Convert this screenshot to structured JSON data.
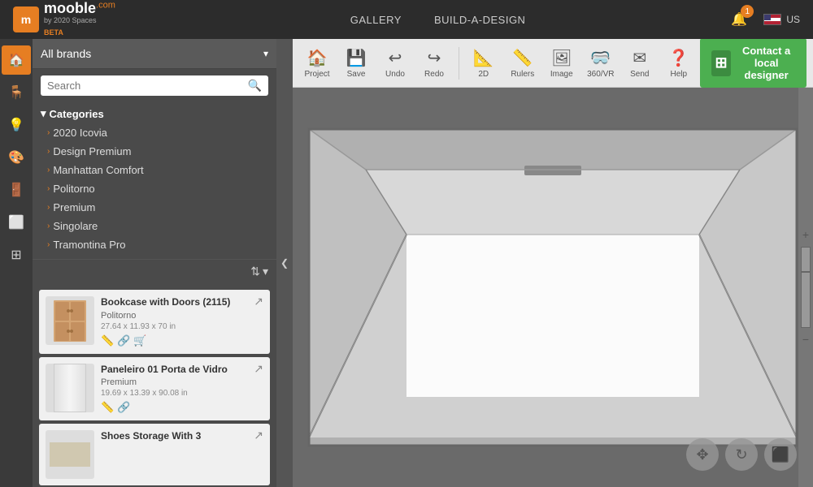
{
  "header": {
    "logo_main": "mooble",
    "logo_com": ".com",
    "logo_sub": "by 2020 Spaces",
    "logo_beta": "BETA",
    "nav_gallery": "GALLERY",
    "nav_build": "BUILD-A-DESIGN",
    "notification_count": "1",
    "lang": "US"
  },
  "sidebar": {
    "brand_dropdown": "All brands",
    "search_placeholder": "Search",
    "categories_label": "Categories",
    "categories": [
      {
        "label": "2020 Icovia"
      },
      {
        "label": "Design Premium"
      },
      {
        "label": "Manhattan Comfort"
      },
      {
        "label": "Politorno"
      },
      {
        "label": "Premium"
      },
      {
        "label": "Singolare"
      },
      {
        "label": "Tramontina Pro"
      }
    ]
  },
  "products": [
    {
      "name": "Bookcase with Doors (2115)",
      "brand": "Politorno",
      "dims": "27.64 x 11.93 x 70 in"
    },
    {
      "name": "Paneleiro 01 Porta de Vidro",
      "brand": "Premium",
      "dims": "19.69 x 13.39 x 90.08 in"
    },
    {
      "name": "Shoes Storage With 3",
      "brand": "",
      "dims": ""
    }
  ],
  "toolbar": {
    "project_label": "Project",
    "save_label": "Save",
    "undo_label": "Undo",
    "redo_label": "Redo",
    "twod_label": "2D",
    "rulers_label": "Rulers",
    "image_label": "Image",
    "vr_label": "360/VR",
    "send_label": "Send",
    "help_label": "Help",
    "contact_line1": "Contact a local",
    "contact_line2": "designer"
  },
  "icons": {
    "arrow_left": "❮",
    "arrow_right": "❯",
    "arrow_down": "▾",
    "arrow_up": "▴",
    "search": "🔍",
    "sort": "⇅",
    "share": "↗",
    "cart": "🛒",
    "edit": "✏",
    "move": "✥",
    "rotate": "↻",
    "cube": "⬛",
    "expand": "⛶",
    "plus": "+",
    "minus": "−"
  }
}
